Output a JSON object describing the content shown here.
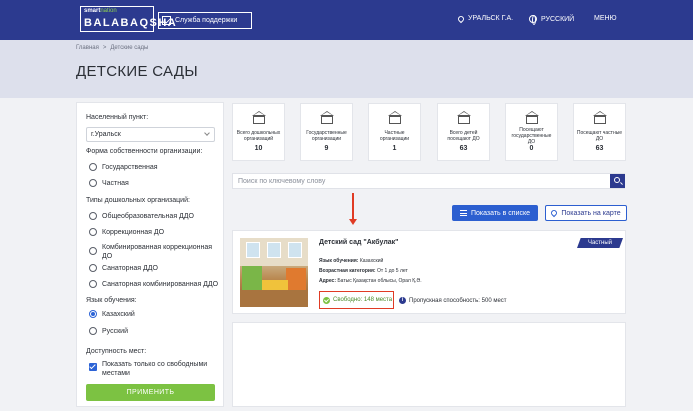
{
  "header": {
    "logo_small_brand": "smart",
    "logo_small_rest": "nation",
    "logo_text": "BALABAQSHA",
    "support_label": "Служба поддержки",
    "city_label": "УРАЛЬСК Г.А.",
    "language_label": "РУССКИЙ",
    "menu_label": "МЕНЮ"
  },
  "breadcrumb": {
    "home": "Главная",
    "separator": ">",
    "current": "Детские сады"
  },
  "page": {
    "title": "ДЕТСКИЕ САДЫ"
  },
  "filters": {
    "locality_label": "Населенный пункт:",
    "locality_value": "г.Уральск",
    "ownership_label": "Форма собственности организации:",
    "ownership_options": [
      "Государственная",
      "Частная"
    ],
    "types_label": "Типы дошкольных организаций:",
    "type_options": [
      "Общеобразовательная ДДО",
      "Коррекционная ДО",
      "Комбинированная коррекционная ДО",
      "Санаторная ДДО",
      "Санаторная комбинированная ДДО"
    ],
    "language_label": "Язык обучения:",
    "language_options": [
      "Казахский",
      "Русский"
    ],
    "language_selected": "Казахский",
    "availability_label": "Доступность мест:",
    "availability_checkbox": "Показать только со свободными местами",
    "apply_label": "ПРИМЕНИТЬ"
  },
  "stats": [
    {
      "label": "Всего дошкольных организаций",
      "value": "10"
    },
    {
      "label": "Государственные организации",
      "value": "9"
    },
    {
      "label": "Частные организации",
      "value": "1"
    },
    {
      "label": "Всего детей посещают ДО",
      "value": "63"
    },
    {
      "label": "Посещают государственные ДО",
      "value": "0"
    },
    {
      "label": "Посещают частные ДО",
      "value": "63"
    }
  ],
  "search": {
    "placeholder": "Поиск по ключевому слову"
  },
  "view_buttons": {
    "list_label": "Показать в списке",
    "map_label": "Показать на карте"
  },
  "card": {
    "title": "Детский сад \"Акбулак\"",
    "badge": "Частный",
    "language_key": "Язык обучения:",
    "language_value": "Казахский",
    "age_key": "Возрастная категория:",
    "age_value": "От 1 до 5 лет",
    "address_key": "Адрес:",
    "address_value": "Батыс Қазақстан облысы, Орал Қ.Ә.",
    "free_label": "Свободно: 148 места",
    "capacity_label": "Пропускная способность: 500 мест"
  },
  "colors": {
    "primary": "#2c3a8f",
    "accent_green": "#7cc242",
    "highlight_red": "#e03b24"
  }
}
